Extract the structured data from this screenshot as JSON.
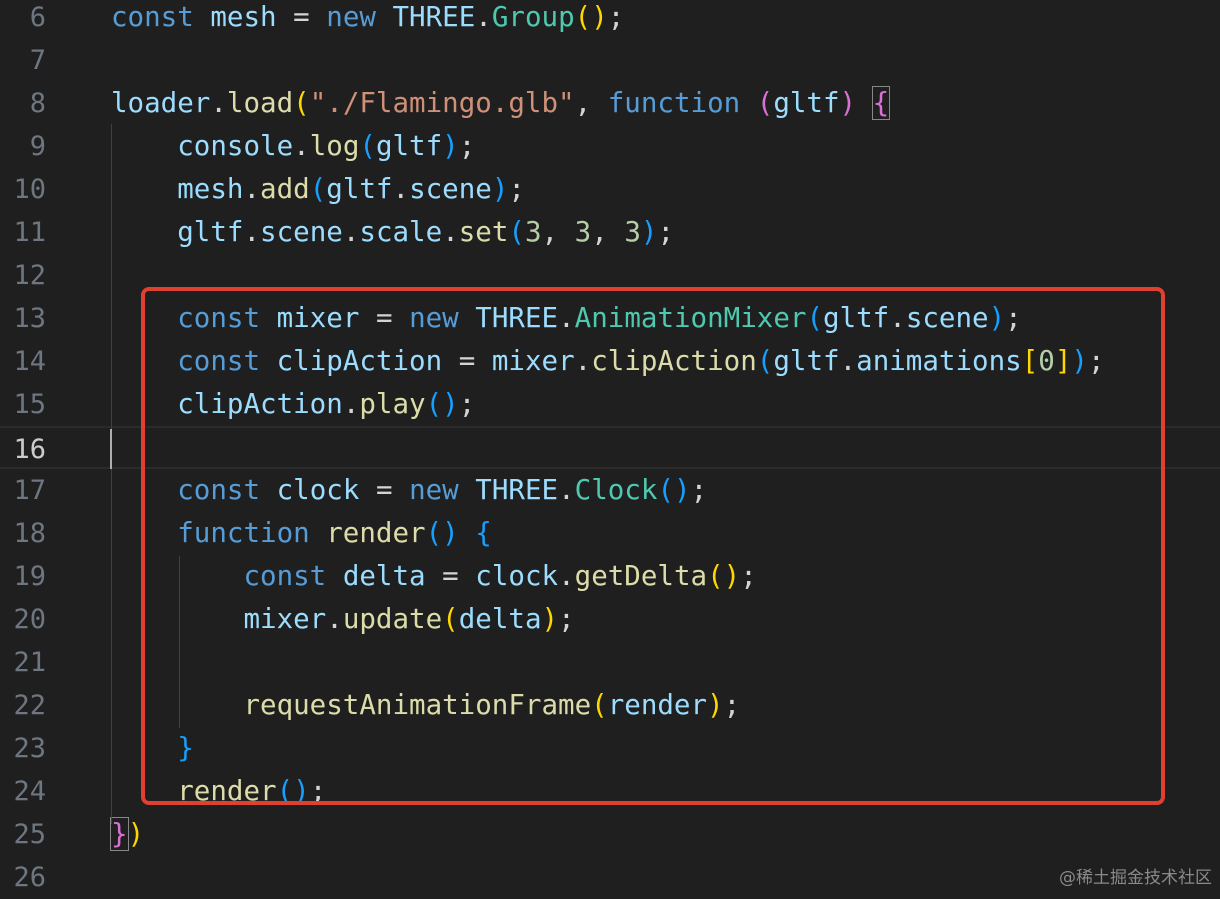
{
  "theme": {
    "background": "#1f1f1f",
    "highlight_box": "#e0402f",
    "colors": {
      "keyword": "#569cd6",
      "variable": "#9cdcfe",
      "class": "#4ec9b0",
      "function": "#dcdcaa",
      "string": "#ce9178",
      "number": "#b5cea8",
      "punct": "#d4d4d4",
      "paren_gold": "#ffd700",
      "paren_purple": "#da70d6",
      "paren_blue": "#179fff"
    }
  },
  "editor": {
    "current_line": 16,
    "lines": [
      {
        "n": "6",
        "tokens": [
          [
            "const",
            "keyword"
          ],
          [
            " ",
            "punct"
          ],
          [
            "mesh",
            "variable"
          ],
          [
            " = ",
            "punct"
          ],
          [
            "new",
            "keyword"
          ],
          [
            " ",
            "punct"
          ],
          [
            "THREE",
            "variable"
          ],
          [
            ".",
            "punct"
          ],
          [
            "Group",
            "class"
          ],
          [
            "()",
            "paren_gold"
          ],
          [
            ";",
            "punct"
          ]
        ]
      },
      {
        "n": "7",
        "tokens": []
      },
      {
        "n": "8",
        "tokens": [
          [
            "loader",
            "variable"
          ],
          [
            ".",
            "punct"
          ],
          [
            "load",
            "function"
          ],
          [
            "(",
            "paren_gold"
          ],
          [
            "\"./Flamingo.glb\"",
            "string"
          ],
          [
            ", ",
            "punct"
          ],
          [
            "function",
            "keyword"
          ],
          [
            " ",
            "punct"
          ],
          [
            "(",
            "paren_purple"
          ],
          [
            "gltf",
            "variable"
          ],
          [
            ")",
            "paren_purple"
          ],
          [
            " ",
            "punct"
          ],
          [
            "{",
            "paren_purple"
          ]
        ]
      },
      {
        "n": "9",
        "tokens": [
          [
            "    ",
            "punct"
          ],
          [
            "console",
            "variable"
          ],
          [
            ".",
            "punct"
          ],
          [
            "log",
            "function"
          ],
          [
            "(",
            "paren_blue"
          ],
          [
            "gltf",
            "variable"
          ],
          [
            ")",
            "paren_blue"
          ],
          [
            ";",
            "punct"
          ]
        ]
      },
      {
        "n": "10",
        "tokens": [
          [
            "    ",
            "punct"
          ],
          [
            "mesh",
            "variable"
          ],
          [
            ".",
            "punct"
          ],
          [
            "add",
            "function"
          ],
          [
            "(",
            "paren_blue"
          ],
          [
            "gltf",
            "variable"
          ],
          [
            ".",
            "punct"
          ],
          [
            "scene",
            "variable"
          ],
          [
            ")",
            "paren_blue"
          ],
          [
            ";",
            "punct"
          ]
        ]
      },
      {
        "n": "11",
        "tokens": [
          [
            "    ",
            "punct"
          ],
          [
            "gltf",
            "variable"
          ],
          [
            ".",
            "punct"
          ],
          [
            "scene",
            "variable"
          ],
          [
            ".",
            "punct"
          ],
          [
            "scale",
            "variable"
          ],
          [
            ".",
            "punct"
          ],
          [
            "set",
            "function"
          ],
          [
            "(",
            "paren_blue"
          ],
          [
            "3",
            "number"
          ],
          [
            ", ",
            "punct"
          ],
          [
            "3",
            "number"
          ],
          [
            ", ",
            "punct"
          ],
          [
            "3",
            "number"
          ],
          [
            ")",
            "paren_blue"
          ],
          [
            ";",
            "punct"
          ]
        ]
      },
      {
        "n": "12",
        "tokens": []
      },
      {
        "n": "13",
        "tokens": [
          [
            "    ",
            "punct"
          ],
          [
            "const",
            "keyword"
          ],
          [
            " ",
            "punct"
          ],
          [
            "mixer",
            "variable"
          ],
          [
            " = ",
            "punct"
          ],
          [
            "new",
            "keyword"
          ],
          [
            " ",
            "punct"
          ],
          [
            "THREE",
            "variable"
          ],
          [
            ".",
            "punct"
          ],
          [
            "AnimationMixer",
            "class"
          ],
          [
            "(",
            "paren_blue"
          ],
          [
            "gltf",
            "variable"
          ],
          [
            ".",
            "punct"
          ],
          [
            "scene",
            "variable"
          ],
          [
            ")",
            "paren_blue"
          ],
          [
            ";",
            "punct"
          ]
        ]
      },
      {
        "n": "14",
        "tokens": [
          [
            "    ",
            "punct"
          ],
          [
            "const",
            "keyword"
          ],
          [
            " ",
            "punct"
          ],
          [
            "clipAction",
            "variable"
          ],
          [
            " = ",
            "punct"
          ],
          [
            "mixer",
            "variable"
          ],
          [
            ".",
            "punct"
          ],
          [
            "clipAction",
            "function"
          ],
          [
            "(",
            "paren_blue"
          ],
          [
            "gltf",
            "variable"
          ],
          [
            ".",
            "punct"
          ],
          [
            "animations",
            "variable"
          ],
          [
            "[",
            "paren_gold"
          ],
          [
            "0",
            "number"
          ],
          [
            "]",
            "paren_gold"
          ],
          [
            ")",
            "paren_blue"
          ],
          [
            ";",
            "punct"
          ]
        ]
      },
      {
        "n": "15",
        "tokens": [
          [
            "    ",
            "punct"
          ],
          [
            "clipAction",
            "variable"
          ],
          [
            ".",
            "punct"
          ],
          [
            "play",
            "function"
          ],
          [
            "()",
            "paren_blue"
          ],
          [
            ";",
            "punct"
          ]
        ]
      },
      {
        "n": "16",
        "tokens": []
      },
      {
        "n": "17",
        "tokens": [
          [
            "    ",
            "punct"
          ],
          [
            "const",
            "keyword"
          ],
          [
            " ",
            "punct"
          ],
          [
            "clock",
            "variable"
          ],
          [
            " = ",
            "punct"
          ],
          [
            "new",
            "keyword"
          ],
          [
            " ",
            "punct"
          ],
          [
            "THREE",
            "variable"
          ],
          [
            ".",
            "punct"
          ],
          [
            "Clock",
            "class"
          ],
          [
            "()",
            "paren_blue"
          ],
          [
            ";",
            "punct"
          ]
        ]
      },
      {
        "n": "18",
        "tokens": [
          [
            "    ",
            "punct"
          ],
          [
            "function",
            "keyword"
          ],
          [
            " ",
            "punct"
          ],
          [
            "render",
            "function"
          ],
          [
            "()",
            "paren_blue"
          ],
          [
            " ",
            "punct"
          ],
          [
            "{",
            "paren_blue"
          ]
        ]
      },
      {
        "n": "19",
        "tokens": [
          [
            "        ",
            "punct"
          ],
          [
            "const",
            "keyword"
          ],
          [
            " ",
            "punct"
          ],
          [
            "delta",
            "variable"
          ],
          [
            " = ",
            "punct"
          ],
          [
            "clock",
            "variable"
          ],
          [
            ".",
            "punct"
          ],
          [
            "getDelta",
            "function"
          ],
          [
            "()",
            "paren_gold"
          ],
          [
            ";",
            "punct"
          ]
        ]
      },
      {
        "n": "20",
        "tokens": [
          [
            "        ",
            "punct"
          ],
          [
            "mixer",
            "variable"
          ],
          [
            ".",
            "punct"
          ],
          [
            "update",
            "function"
          ],
          [
            "(",
            "paren_gold"
          ],
          [
            "delta",
            "variable"
          ],
          [
            ")",
            "paren_gold"
          ],
          [
            ";",
            "punct"
          ]
        ]
      },
      {
        "n": "21",
        "tokens": []
      },
      {
        "n": "22",
        "tokens": [
          [
            "        ",
            "punct"
          ],
          [
            "requestAnimationFrame",
            "function"
          ],
          [
            "(",
            "paren_gold"
          ],
          [
            "render",
            "variable"
          ],
          [
            ")",
            "paren_gold"
          ],
          [
            ";",
            "punct"
          ]
        ]
      },
      {
        "n": "23",
        "tokens": [
          [
            "    ",
            "punct"
          ],
          [
            "}",
            "paren_blue"
          ]
        ]
      },
      {
        "n": "24",
        "tokens": [
          [
            "    ",
            "punct"
          ],
          [
            "render",
            "function"
          ],
          [
            "()",
            "paren_blue"
          ],
          [
            ";",
            "punct"
          ]
        ]
      },
      {
        "n": "25",
        "tokens": [
          [
            "}",
            "paren_purple"
          ],
          [
            ")",
            "paren_gold"
          ]
        ]
      },
      {
        "n": "26",
        "tokens": []
      }
    ]
  },
  "watermark": "@稀土掘金技术社区"
}
